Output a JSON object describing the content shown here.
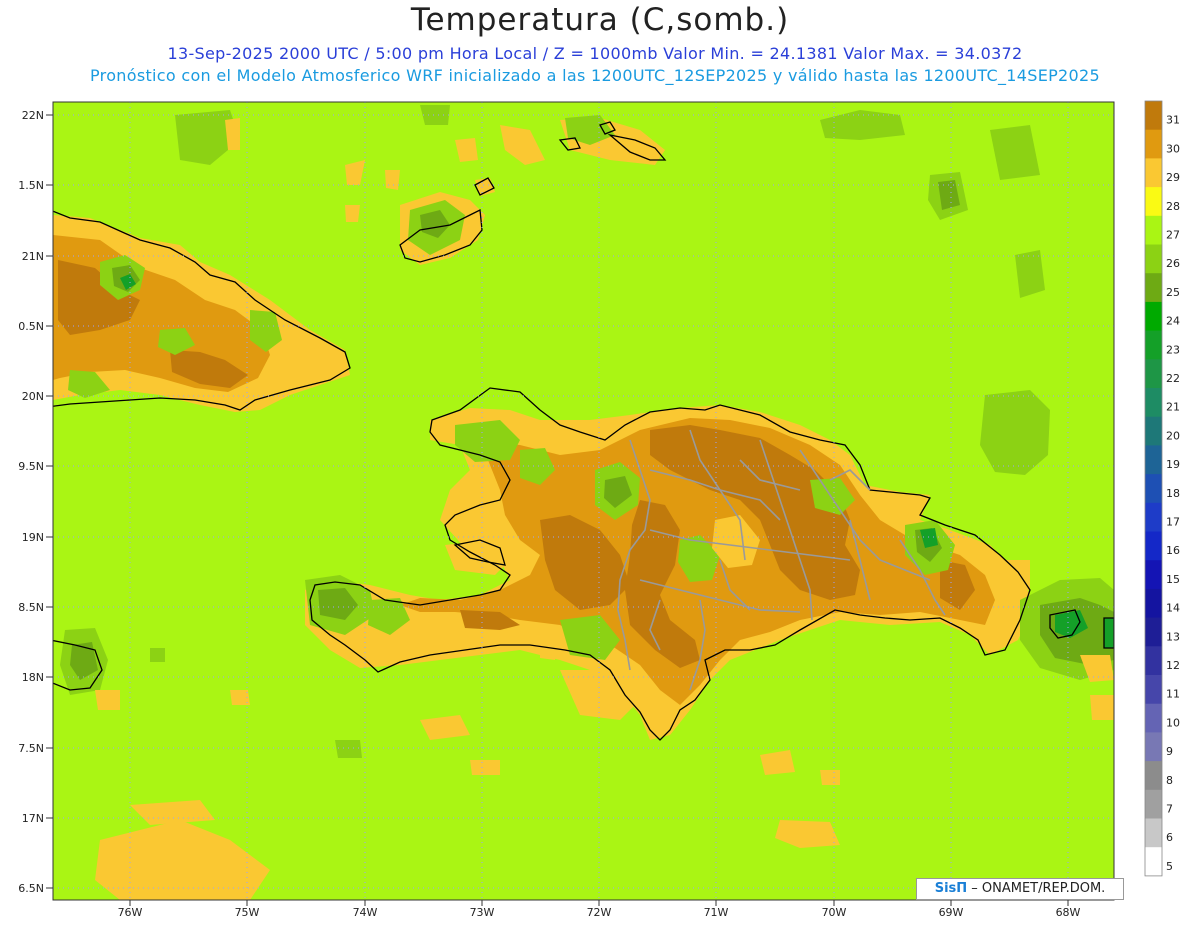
{
  "header": {
    "title": "Temperatura (C,somb.)",
    "subtitle_1": "13-Sep-2025  2000 UTC / 5:00 pm Hora Local / Z = 1000mb     Valor Min. = 24.1381   Valor Max. = 34.0372",
    "subtitle_2": "Pronóstico con el Modelo Atmosferico WRF inicializado a las 1200UTC_12SEP2025 y válido hasta las  1200UTC_14SEP2025"
  },
  "axes": {
    "lat_labels": [
      "22N",
      "1.5N",
      "21N",
      "0.5N",
      "20N",
      "9.5N",
      "19N",
      "8.5N",
      "18N",
      "7.5N",
      "17N",
      "6.5N"
    ],
    "lon_labels": [
      "76W",
      "75W",
      "74W",
      "73W",
      "72W",
      "71W",
      "70W",
      "69W",
      "68W"
    ]
  },
  "colorbar": {
    "labels": [
      "31",
      "30",
      "29",
      "28",
      "27",
      "26",
      "25",
      "24",
      "23",
      "22",
      "21",
      "20",
      "19",
      "18",
      "17",
      "16",
      "15",
      "14",
      "13",
      "12",
      "11",
      "10",
      "9",
      "8",
      "7",
      "6",
      "5"
    ],
    "colors": [
      "#c07a0c",
      "#e09a10",
      "#fac832",
      "#fafa14",
      "#aaf514",
      "#8cd214",
      "#6eaa14",
      "#00aa00",
      "#14a028",
      "#1e9646",
      "#1e8c64",
      "#1e7878",
      "#1e6496",
      "#1e50b4",
      "#1e3cc8",
      "#1428c8",
      "#1414b4",
      "#1414a0",
      "#1e1e96",
      "#3232a0",
      "#4646aa",
      "#6464b4",
      "#7878b4",
      "#8c8c8c",
      "#a0a0a0",
      "#c8c8c8",
      "#ffffff"
    ]
  },
  "credit": {
    "brand": "SisΠ",
    "text": " – ONAMET/REP.DOM."
  }
}
